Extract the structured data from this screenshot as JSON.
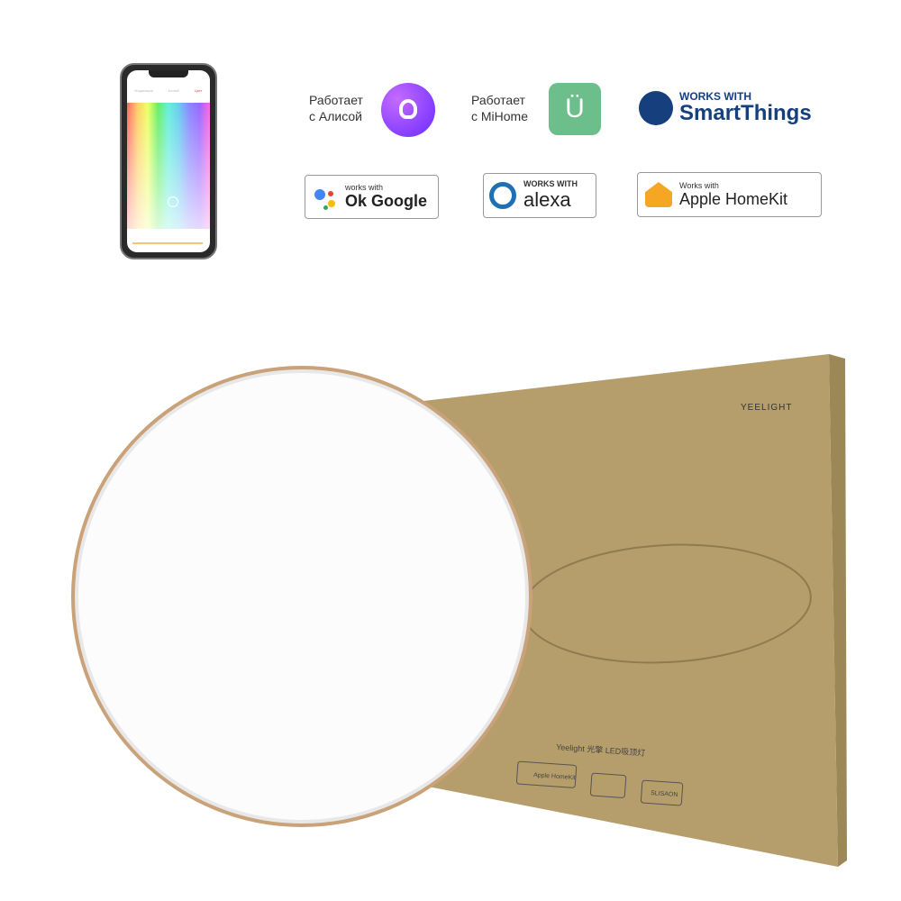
{
  "phone": {
    "tabs": [
      "Индикация",
      "Белый",
      "Цвет"
    ]
  },
  "badges": {
    "alice": {
      "line1": "Работает",
      "line2": "с Алисой",
      "color": "#8b3dff"
    },
    "mihome": {
      "line1": "Работает",
      "line2": "с MiHome",
      "color": "#6cbf8b"
    },
    "smartthings": {
      "line1": "WORKS WITH",
      "line2": "SmartThings",
      "color": "#15407d"
    },
    "google": {
      "line1": "works with",
      "line2": "Ok Google"
    },
    "alexa": {
      "line1": "WORKS WITH",
      "line2": "alexa",
      "color": "#1f6fb5"
    },
    "homekit": {
      "line1": "Works with",
      "line2": "Apple HomeKit",
      "color": "#f5a623"
    }
  },
  "box": {
    "brand": "YEELIGHT",
    "product": "Yeelight 光擎 LED吸顶灯",
    "label1": "Apple HomeKit",
    "label3": "SLISAON",
    "color": "#b59e6b"
  },
  "lamp": {
    "rim_color": "#c9a27a"
  }
}
